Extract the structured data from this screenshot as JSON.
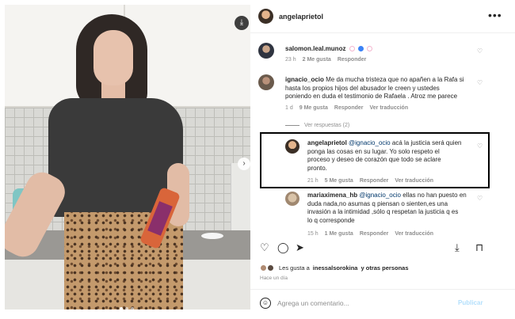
{
  "post": {
    "username": "angelaprietol",
    "more_icon": "more-horizontal-icon"
  },
  "comments": [
    {
      "username": "salomon.leal.munoz",
      "text": "",
      "emojis": [
        "#f3b6cf",
        "#3b82f6",
        "#f3b6cf"
      ],
      "age": "23 h",
      "likes": "2 Me gusta",
      "reply": "Responder"
    },
    {
      "username": "ignacio_ocio",
      "text_lines": [
        "Me da mucha tristeza que no apañen a la Rafa si",
        "hasta los propios hijos del abusador le creen y ustedes",
        "poniendo en duda el testimonio de Rafaela . Atroz me parece"
      ],
      "age": "1 d",
      "likes": "9 Me gusta",
      "reply": "Responder",
      "translate": "Ver traducción"
    }
  ],
  "view_replies": "Ver respuestas (2)",
  "replies": [
    {
      "username": "angelaprietol",
      "mention": "@ignacio_ocio",
      "text_lines": [
        "acá la justicia será quien",
        "ponga las cosas en su lugar. Yo solo respeto el",
        "proceso y deseo de corazón que todo se aclare",
        "pronto."
      ],
      "age": "21 h",
      "likes": "5 Me gusta",
      "reply": "Responder",
      "translate": "Ver traducción"
    },
    {
      "username": "mariaximena_hb",
      "mention": "@ignacio_ocio",
      "text_lines": [
        "ellas no han puesto en",
        "duda nada,no asumas q piensan o sienten,es una",
        "invasión a la intimidad ,sólo q respetan la justicia q es",
        "lo q corresponde"
      ],
      "age": "15 h",
      "likes": "1 Me gusta",
      "reply": "Responder",
      "translate": "Ver traducción"
    }
  ],
  "likes_line": {
    "prefix": "Les gusta a",
    "user": "inessalsorokina",
    "suffix": "y otras personas"
  },
  "posted_time": "Hace un día",
  "comment_box": {
    "placeholder": "Agrega un comentario...",
    "publish_label": "Publicar"
  }
}
